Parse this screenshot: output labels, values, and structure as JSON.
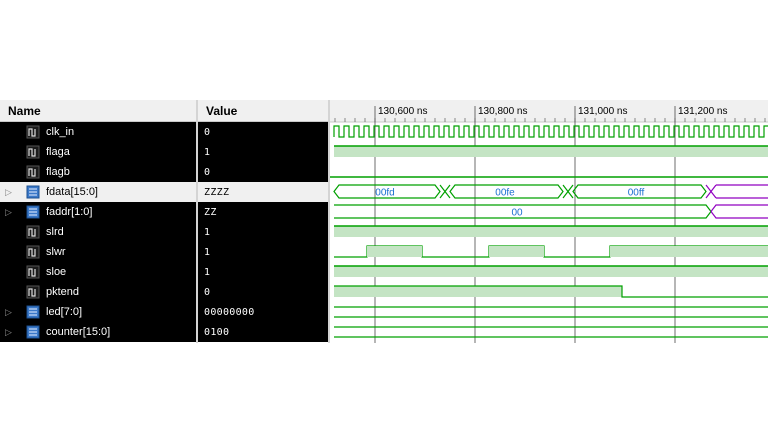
{
  "headers": {
    "name": "Name",
    "value": "Value"
  },
  "signals": [
    {
      "name": "clk_in",
      "value": "0",
      "kind": "bit",
      "expandable": false
    },
    {
      "name": "flaga",
      "value": "1",
      "kind": "bit",
      "expandable": false
    },
    {
      "name": "flagb",
      "value": "0",
      "kind": "bit",
      "expandable": false
    },
    {
      "name": "fdata[15:0]",
      "value": "ZZZZ",
      "kind": "bus",
      "expandable": true,
      "selected": true
    },
    {
      "name": "faddr[1:0]",
      "value": "ZZ",
      "kind": "bus",
      "expandable": true
    },
    {
      "name": "slrd",
      "value": "1",
      "kind": "bit",
      "expandable": false
    },
    {
      "name": "slwr",
      "value": "1",
      "kind": "bit",
      "expandable": false
    },
    {
      "name": "sloe",
      "value": "1",
      "kind": "bit",
      "expandable": false
    },
    {
      "name": "pktend",
      "value": "0",
      "kind": "bit",
      "expandable": false
    },
    {
      "name": "led[7:0]",
      "value": "00000000",
      "kind": "bus",
      "expandable": true
    },
    {
      "name": "counter[15:0]",
      "value": "0100",
      "kind": "bus",
      "expandable": true
    }
  ],
  "timeline": {
    "labels": [
      "130,600 ns",
      "130,800 ns",
      "131,000 ns",
      "131,200 ns"
    ]
  },
  "bus_values": {
    "fdata": [
      "00fd",
      "00fe",
      "00ff"
    ],
    "faddr": [
      "00"
    ]
  },
  "colors": {
    "wave": "#00a000",
    "fill": "#c4e4c4",
    "bus_label": "#1a6fd0",
    "highz": "#9000c0",
    "cursor_grid": "#4a4a4a"
  }
}
